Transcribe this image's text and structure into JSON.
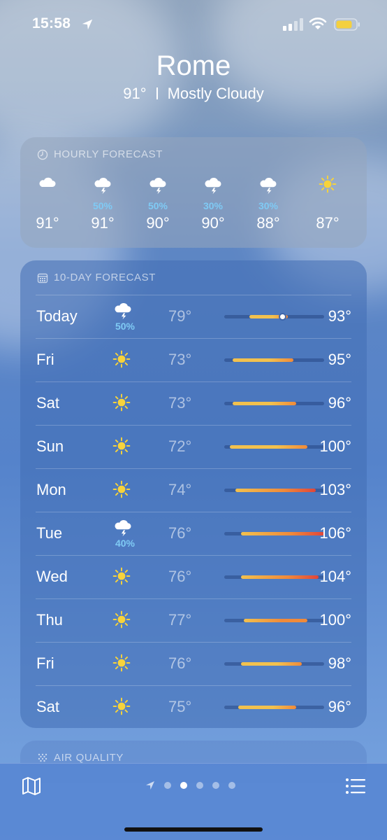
{
  "status_bar": {
    "time": "15:58",
    "battery_color": "#f4d03f"
  },
  "header": {
    "city": "Rome",
    "temperature": "91°",
    "condition": "Mostly Cloudy"
  },
  "hourly": {
    "title": "HOURLY FORECAST",
    "items": [
      {
        "icon": "cloud-icon",
        "pop": "",
        "temp": "91°"
      },
      {
        "icon": "thunderstorm-icon",
        "pop": "50%",
        "temp": "91°"
      },
      {
        "icon": "thunderstorm-icon",
        "pop": "50%",
        "temp": "90°"
      },
      {
        "icon": "thunderstorm-icon",
        "pop": "30%",
        "temp": "90°"
      },
      {
        "icon": "thunderstorm-icon",
        "pop": "30%",
        "temp": "88°"
      },
      {
        "icon": "sun-icon",
        "pop": "",
        "temp": "87°"
      }
    ]
  },
  "ten_day": {
    "title": "10-DAY FORECAST",
    "range_min": 70,
    "range_max": 106,
    "current_temp": 91,
    "days": [
      {
        "day": "Today",
        "icon": "thunderstorm-icon",
        "pop": "50%",
        "low": "79°",
        "high": "93°",
        "low_val": 79,
        "high_val": 93
      },
      {
        "day": "Fri",
        "icon": "sun-icon",
        "pop": "",
        "low": "73°",
        "high": "95°",
        "low_val": 73,
        "high_val": 95
      },
      {
        "day": "Sat",
        "icon": "sun-icon",
        "pop": "",
        "low": "73°",
        "high": "96°",
        "low_val": 73,
        "high_val": 96
      },
      {
        "day": "Sun",
        "icon": "sun-icon",
        "pop": "",
        "low": "72°",
        "high": "100°",
        "low_val": 72,
        "high_val": 100
      },
      {
        "day": "Mon",
        "icon": "sun-icon",
        "pop": "",
        "low": "74°",
        "high": "103°",
        "low_val": 74,
        "high_val": 103
      },
      {
        "day": "Tue",
        "icon": "thunderstorm-icon",
        "pop": "40%",
        "low": "76°",
        "high": "106°",
        "low_val": 76,
        "high_val": 106
      },
      {
        "day": "Wed",
        "icon": "sun-icon",
        "pop": "",
        "low": "76°",
        "high": "104°",
        "low_val": 76,
        "high_val": 104
      },
      {
        "day": "Thu",
        "icon": "sun-icon",
        "pop": "",
        "low": "77°",
        "high": "100°",
        "low_val": 77,
        "high_val": 100
      },
      {
        "day": "Fri",
        "icon": "sun-icon",
        "pop": "",
        "low": "76°",
        "high": "98°",
        "low_val": 76,
        "high_val": 98
      },
      {
        "day": "Sat",
        "icon": "sun-icon",
        "pop": "",
        "low": "75°",
        "high": "96°",
        "low_val": 75,
        "high_val": 96
      }
    ]
  },
  "air_quality": {
    "title": "AIR QUALITY"
  },
  "bottom_bar": {
    "page_count": 5,
    "active_page": 1
  },
  "colors": {
    "pop_blue": "#7fcaf4",
    "sun_yellow": "#f7d33b",
    "bar_cool": "#f2c14e",
    "bar_warm": "#f08a3a",
    "bar_hot": "#e0453a"
  }
}
